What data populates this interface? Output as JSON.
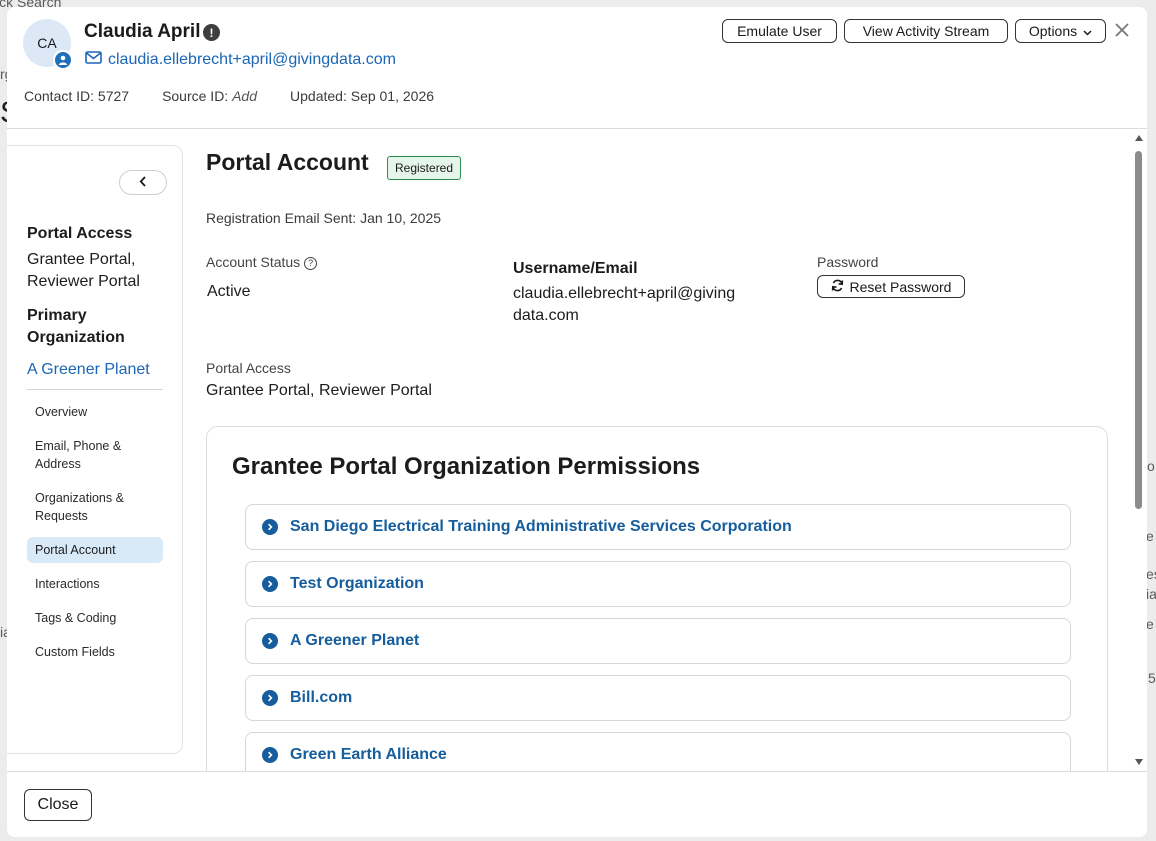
{
  "background": {
    "fragments": [
      "ick Search",
      "rg",
      "S",
      "ia",
      "tio",
      "e",
      "es",
      "ia",
      "e",
      "5"
    ]
  },
  "header": {
    "avatar_initials": "CA",
    "name": "Claudia April",
    "email": "claudia.ellebrecht+april@givingdata.com",
    "contact_id": "Contact ID: 5727",
    "source_id_label": "Source ID:",
    "source_id_value": "Add",
    "updated": "Updated: Sep 01, 2026",
    "buttons": {
      "emulate": "Emulate User",
      "activity": "View Activity Stream",
      "options": "Options"
    }
  },
  "sidebar": {
    "portal_access_heading": "Portal Access",
    "portal_access_value_line1": "Grantee Portal,",
    "portal_access_value_line2": "Reviewer Portal",
    "primary_org_heading_line1": "Primary",
    "primary_org_heading_line2": "Organization",
    "primary_org_value": "A Greener Planet",
    "nav": [
      {
        "label_line1": "Overview",
        "label_line2": ""
      },
      {
        "label_line1": "Email, Phone &",
        "label_line2": "Address"
      },
      {
        "label_line1": "Organizations &",
        "label_line2": "Requests"
      },
      {
        "label_line1": "Portal Account",
        "label_line2": ""
      },
      {
        "label_line1": "Interactions",
        "label_line2": ""
      },
      {
        "label_line1": "Tags & Coding",
        "label_line2": ""
      },
      {
        "label_line1": "Custom Fields",
        "label_line2": ""
      }
    ],
    "active_nav": "Portal Account"
  },
  "content": {
    "title": "Portal Account",
    "status_badge": "Registered",
    "registration_sent": "Registration Email Sent: Jan 10, 2025",
    "account_status_label": "Account Status",
    "account_status_value": "Active",
    "username_label": "Username/Email",
    "username_value_line1": "claudia.ellebrecht+april@giving",
    "username_value_line2": "data.com",
    "password_label": "Password",
    "reset_password_button": "Reset Password",
    "portal_access_label": "Portal Access",
    "portal_access_value": "Grantee Portal, Reviewer Portal",
    "permissions_title": "Grantee Portal Organization Permissions",
    "organizations": [
      "San Diego Electrical Training Administrative Services Corporation",
      "Test Organization",
      "A Greener Planet",
      "Bill.com",
      "Green Earth Alliance"
    ]
  },
  "footer": {
    "close_button": "Close"
  },
  "colors": {
    "link_blue": "#1b66b5",
    "org_blue": "#155d9c",
    "badge_green": "#2e8a4e",
    "active_nav_bg": "#d8eaf8"
  }
}
